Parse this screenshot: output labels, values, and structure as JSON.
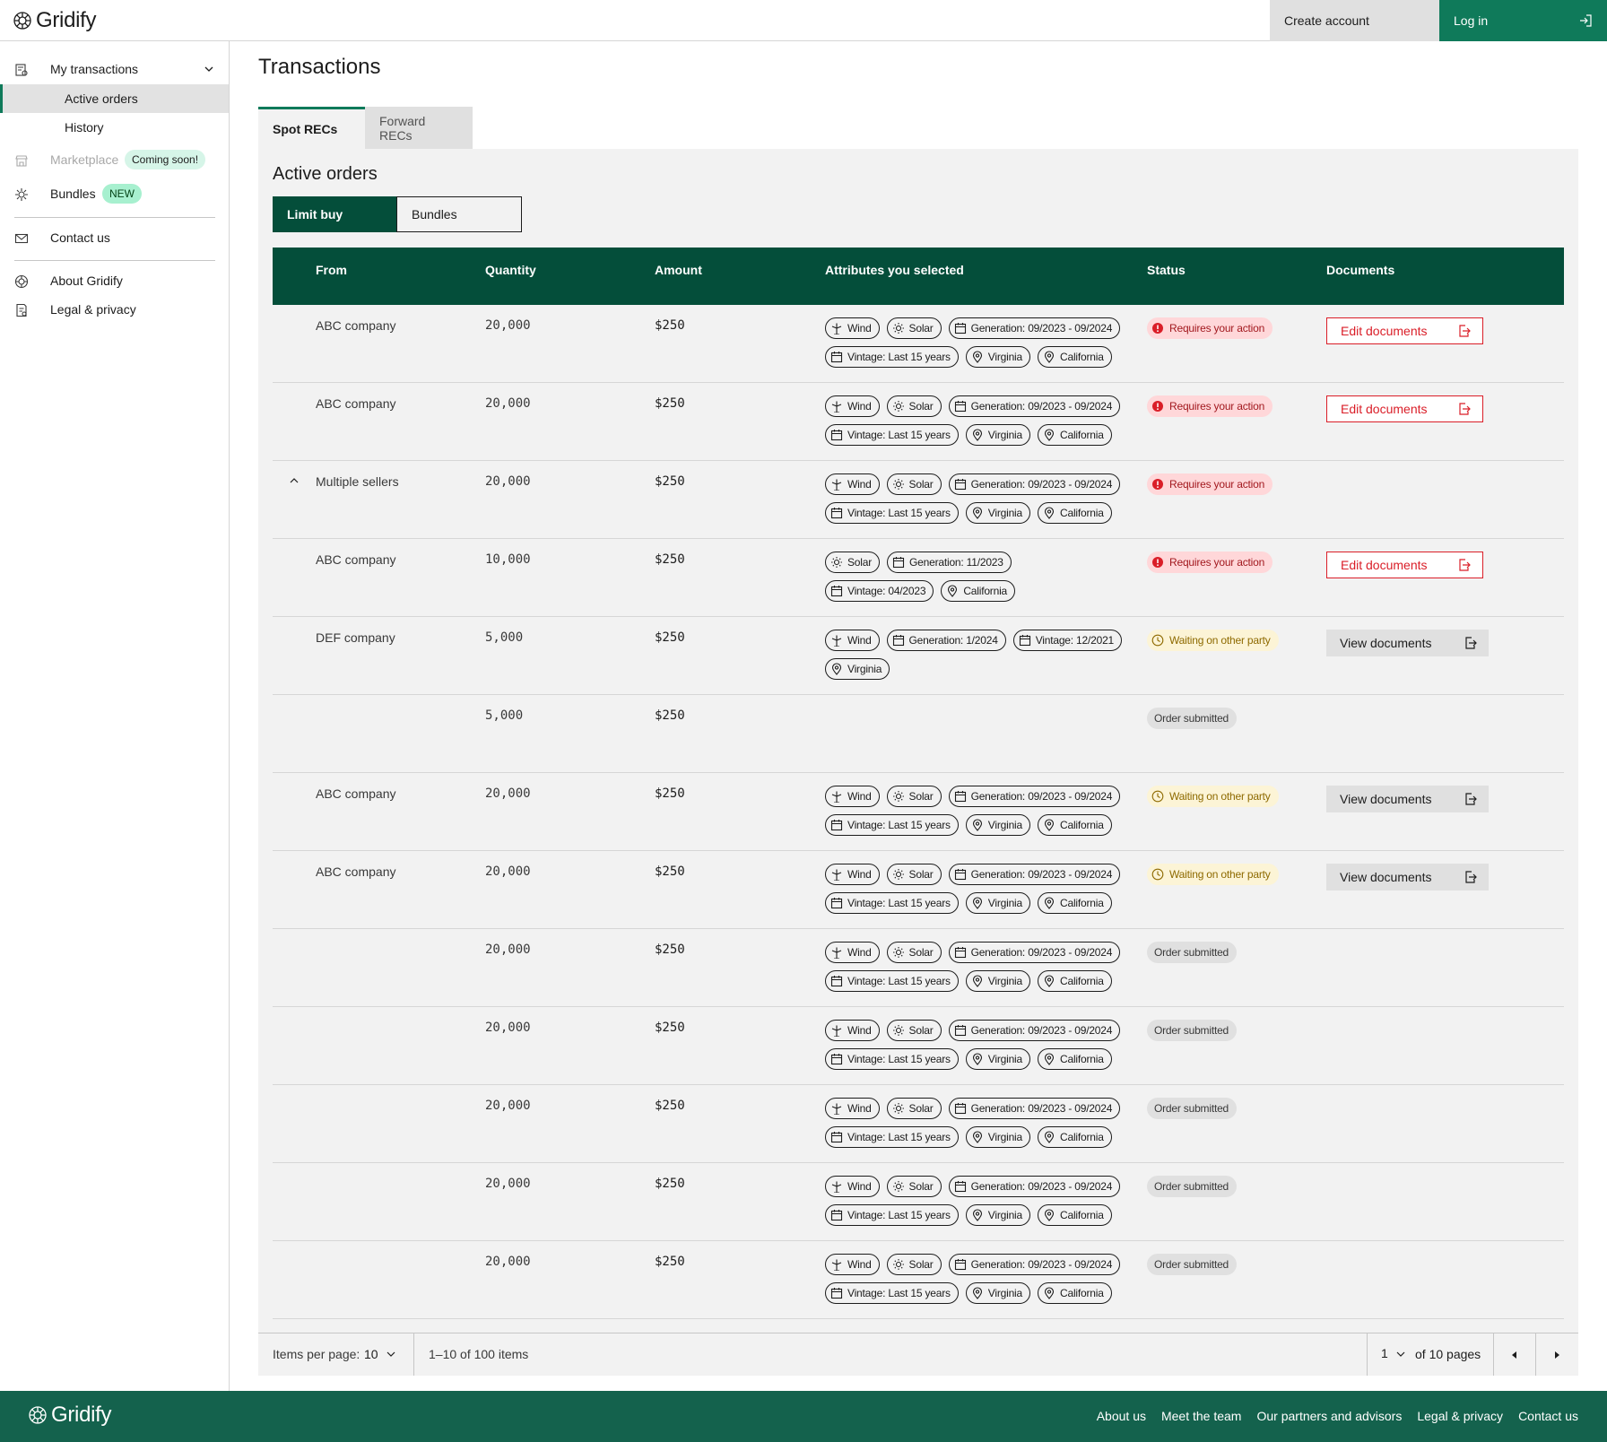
{
  "header": {
    "logo": "Gridify",
    "create_account": "Create account",
    "log_in": "Log in"
  },
  "sidebar": {
    "my_transactions": "My transactions",
    "active_orders": "Active orders",
    "history": "History",
    "marketplace": "Marketplace",
    "coming_soon": "Coming soon!",
    "bundles": "Bundles",
    "new_badge": "NEW",
    "contact_us": "Contact us",
    "about": "About Gridify",
    "legal": "Legal & privacy"
  },
  "page_title": "Transactions",
  "tabs": [
    "Spot RECs",
    "Forward RECs"
  ],
  "section_title": "Active orders",
  "segments": [
    "Limit buy",
    "Bundles"
  ],
  "table": {
    "headers": [
      "From",
      "Quantity",
      "Amount",
      "Attributes you selected",
      "Status",
      "Documents"
    ],
    "rows": [
      {
        "from": "ABC company",
        "qty": "20,000",
        "amt": "$250",
        "expand": false,
        "chips": [
          {
            "icon": "wind-icon",
            "text": "Wind"
          },
          {
            "icon": "sun-icon",
            "text": "Solar"
          },
          {
            "icon": "calendar-icon",
            "text": "Generation: 09/2023 - 09/2024"
          },
          {
            "icon": "calendar-icon",
            "text": "Vintage: Last 15 years"
          },
          {
            "icon": "location-icon",
            "text": "Virginia"
          },
          {
            "icon": "location-icon",
            "text": "California"
          }
        ],
        "status": {
          "type": "red",
          "text": "Requires your action"
        },
        "doc": {
          "type": "edit",
          "text": "Edit documents"
        }
      },
      {
        "from": "ABC company",
        "qty": "20,000",
        "amt": "$250",
        "expand": false,
        "chips": [
          {
            "icon": "wind-icon",
            "text": "Wind"
          },
          {
            "icon": "sun-icon",
            "text": "Solar"
          },
          {
            "icon": "calendar-icon",
            "text": "Generation: 09/2023 - 09/2024"
          },
          {
            "icon": "calendar-icon",
            "text": "Vintage: Last 15 years"
          },
          {
            "icon": "location-icon",
            "text": "Virginia"
          },
          {
            "icon": "location-icon",
            "text": "California"
          }
        ],
        "status": {
          "type": "red",
          "text": "Requires your action"
        },
        "doc": {
          "type": "edit",
          "text": "Edit documents"
        }
      },
      {
        "from": "Multiple sellers",
        "qty": "20,000",
        "amt": "$250",
        "expand": true,
        "chips": [
          {
            "icon": "wind-icon",
            "text": "Wind"
          },
          {
            "icon": "sun-icon",
            "text": "Solar"
          },
          {
            "icon": "calendar-icon",
            "text": "Generation: 09/2023 - 09/2024"
          },
          {
            "icon": "calendar-icon",
            "text": "Vintage: Last 15 years"
          },
          {
            "icon": "location-icon",
            "text": "Virginia"
          },
          {
            "icon": "location-icon",
            "text": "California"
          }
        ],
        "status": {
          "type": "red",
          "text": "Requires your action"
        },
        "doc": null
      },
      {
        "from": "ABC company",
        "qty": "10,000",
        "amt": "$250",
        "expand": false,
        "chips": [
          {
            "icon": "sun-icon",
            "text": "Solar"
          },
          {
            "icon": "calendar-icon",
            "text": "Generation: 11/2023"
          },
          {
            "icon": "calendar-icon",
            "text": "Vintage: 04/2023"
          },
          {
            "icon": "location-icon",
            "text": "California"
          }
        ],
        "status": {
          "type": "red",
          "text": "Requires your action"
        },
        "doc": {
          "type": "edit",
          "text": "Edit documents"
        }
      },
      {
        "from": "DEF company",
        "qty": "5,000",
        "amt": "$250",
        "expand": false,
        "chips": [
          {
            "icon": "wind-icon",
            "text": "Wind"
          },
          {
            "icon": "calendar-icon",
            "text": "Generation: 1/2024"
          },
          {
            "icon": "calendar-icon",
            "text": "Vintage: 12/2021"
          },
          {
            "icon": "location-icon",
            "text": "Virginia"
          }
        ],
        "status": {
          "type": "yellow",
          "text": "Waiting on other party"
        },
        "doc": {
          "type": "view",
          "text": "View documents"
        }
      },
      {
        "from": "",
        "qty": "5,000",
        "amt": "$250",
        "expand": false,
        "chips": [],
        "status": {
          "type": "gray",
          "text": "Order submitted"
        },
        "doc": null
      },
      {
        "from": "ABC company",
        "qty": "20,000",
        "amt": "$250",
        "expand": false,
        "chips": [
          {
            "icon": "wind-icon",
            "text": "Wind"
          },
          {
            "icon": "sun-icon",
            "text": "Solar"
          },
          {
            "icon": "calendar-icon",
            "text": "Generation: 09/2023 - 09/2024"
          },
          {
            "icon": "calendar-icon",
            "text": "Vintage: Last 15 years"
          },
          {
            "icon": "location-icon",
            "text": "Virginia"
          },
          {
            "icon": "location-icon",
            "text": "California"
          }
        ],
        "status": {
          "type": "yellow",
          "text": "Waiting on other party"
        },
        "doc": {
          "type": "view",
          "text": "View documents"
        }
      },
      {
        "from": "ABC company",
        "qty": "20,000",
        "amt": "$250",
        "expand": false,
        "chips": [
          {
            "icon": "wind-icon",
            "text": "Wind"
          },
          {
            "icon": "sun-icon",
            "text": "Solar"
          },
          {
            "icon": "calendar-icon",
            "text": "Generation: 09/2023 - 09/2024"
          },
          {
            "icon": "calendar-icon",
            "text": "Vintage: Last 15 years"
          },
          {
            "icon": "location-icon",
            "text": "Virginia"
          },
          {
            "icon": "location-icon",
            "text": "California"
          }
        ],
        "status": {
          "type": "yellow",
          "text": "Waiting on other party"
        },
        "doc": {
          "type": "view",
          "text": "View documents"
        }
      },
      {
        "from": "",
        "qty": "20,000",
        "amt": "$250",
        "expand": false,
        "chips": [
          {
            "icon": "wind-icon",
            "text": "Wind"
          },
          {
            "icon": "sun-icon",
            "text": "Solar"
          },
          {
            "icon": "calendar-icon",
            "text": "Generation: 09/2023 - 09/2024"
          },
          {
            "icon": "calendar-icon",
            "text": "Vintage: Last 15 years"
          },
          {
            "icon": "location-icon",
            "text": "Virginia"
          },
          {
            "icon": "location-icon",
            "text": "California"
          }
        ],
        "status": {
          "type": "gray",
          "text": "Order submitted"
        },
        "doc": null
      },
      {
        "from": "",
        "qty": "20,000",
        "amt": "$250",
        "expand": false,
        "chips": [
          {
            "icon": "wind-icon",
            "text": "Wind"
          },
          {
            "icon": "sun-icon",
            "text": "Solar"
          },
          {
            "icon": "calendar-icon",
            "text": "Generation: 09/2023 - 09/2024"
          },
          {
            "icon": "calendar-icon",
            "text": "Vintage: Last 15 years"
          },
          {
            "icon": "location-icon",
            "text": "Virginia"
          },
          {
            "icon": "location-icon",
            "text": "California"
          }
        ],
        "status": {
          "type": "gray",
          "text": "Order submitted"
        },
        "doc": null
      },
      {
        "from": "",
        "qty": "20,000",
        "amt": "$250",
        "expand": false,
        "chips": [
          {
            "icon": "wind-icon",
            "text": "Wind"
          },
          {
            "icon": "sun-icon",
            "text": "Solar"
          },
          {
            "icon": "calendar-icon",
            "text": "Generation: 09/2023 - 09/2024"
          },
          {
            "icon": "calendar-icon",
            "text": "Vintage: Last 15 years"
          },
          {
            "icon": "location-icon",
            "text": "Virginia"
          },
          {
            "icon": "location-icon",
            "text": "California"
          }
        ],
        "status": {
          "type": "gray",
          "text": "Order submitted"
        },
        "doc": null
      },
      {
        "from": "",
        "qty": "20,000",
        "amt": "$250",
        "expand": false,
        "chips": [
          {
            "icon": "wind-icon",
            "text": "Wind"
          },
          {
            "icon": "sun-icon",
            "text": "Solar"
          },
          {
            "icon": "calendar-icon",
            "text": "Generation: 09/2023 - 09/2024"
          },
          {
            "icon": "calendar-icon",
            "text": "Vintage: Last 15 years"
          },
          {
            "icon": "location-icon",
            "text": "Virginia"
          },
          {
            "icon": "location-icon",
            "text": "California"
          }
        ],
        "status": {
          "type": "gray",
          "text": "Order submitted"
        },
        "doc": null
      },
      {
        "from": "",
        "qty": "20,000",
        "amt": "$250",
        "expand": false,
        "chips": [
          {
            "icon": "wind-icon",
            "text": "Wind"
          },
          {
            "icon": "sun-icon",
            "text": "Solar"
          },
          {
            "icon": "calendar-icon",
            "text": "Generation: 09/2023 - 09/2024"
          },
          {
            "icon": "calendar-icon",
            "text": "Vintage: Last 15 years"
          },
          {
            "icon": "location-icon",
            "text": "Virginia"
          },
          {
            "icon": "location-icon",
            "text": "California"
          }
        ],
        "status": {
          "type": "gray",
          "text": "Order submitted"
        },
        "doc": null
      }
    ]
  },
  "pagination": {
    "items_per_page_label": "Items per page:",
    "items_per_page": "10",
    "range": "1–10 of 100 items",
    "page": "1",
    "of_pages": "of 10 pages"
  },
  "footer": {
    "logo": "Gridify",
    "links": [
      "About us",
      "Meet the team",
      "Our partners and advisors",
      "Legal & privacy",
      "Contact us"
    ]
  },
  "colors": {
    "brand_green": "#0f7a5a",
    "table_header": "#044e3a",
    "footer_bg": "#14624d",
    "error_red": "#da1e28"
  }
}
